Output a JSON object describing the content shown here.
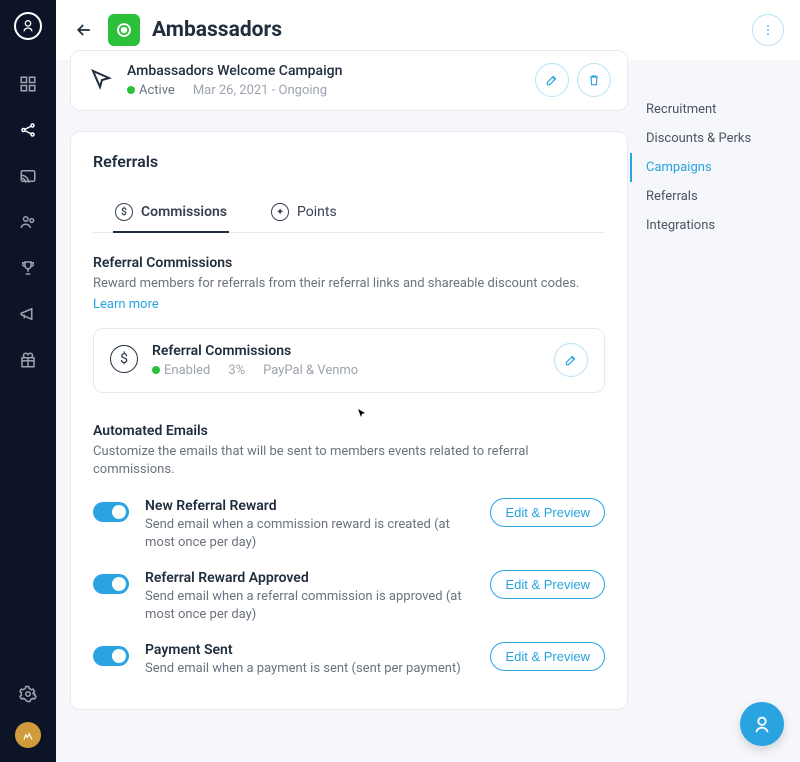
{
  "header": {
    "title": "Ambassadors"
  },
  "inpage_nav": {
    "items": [
      {
        "label": "Recruitment",
        "active": false
      },
      {
        "label": "Discounts & Perks",
        "active": false
      },
      {
        "label": "Campaigns",
        "active": true
      },
      {
        "label": "Referrals",
        "active": false
      },
      {
        "label": "Integrations",
        "active": false
      }
    ]
  },
  "welcome_card": {
    "title": "Ambassadors Welcome Campaign",
    "status": "Active",
    "daterange": "Mar 26, 2021 - Ongoing"
  },
  "referrals": {
    "heading": "Referrals",
    "tabs": {
      "commissions": "Commissions",
      "points": "Points"
    },
    "commissions_section": {
      "title": "Referral Commissions",
      "subtitle": "Reward members for referrals from their referral links and shareable discount codes.",
      "learn_more": "Learn more",
      "box": {
        "title": "Referral Commissions",
        "status": "Enabled",
        "rate": "3%",
        "methods": "PayPal & Venmo"
      }
    },
    "emails_section": {
      "title": "Automated Emails",
      "subtitle": "Customize the emails that will be sent to members events related to referral commissions.",
      "button_label": "Edit & Preview",
      "items": [
        {
          "title": "New Referral Reward",
          "desc": "Send email when a commission reward is created (at most once per day)"
        },
        {
          "title": "Referral Reward Approved",
          "desc": "Send email when a referral commission is approved (at most once per day)"
        },
        {
          "title": "Payment Sent",
          "desc": "Send email when a payment is sent (sent per payment)"
        }
      ]
    }
  }
}
